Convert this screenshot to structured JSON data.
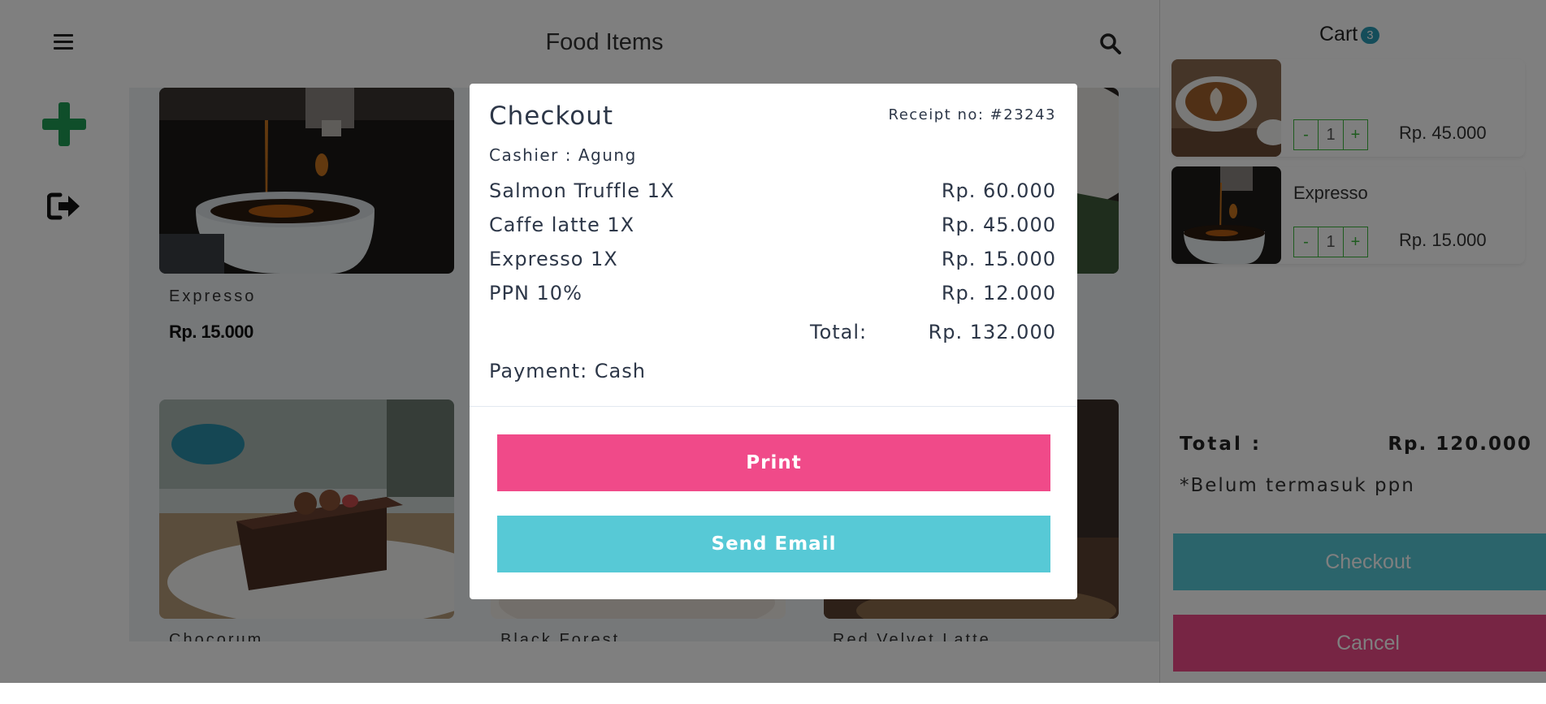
{
  "header": {
    "title": "Food Items"
  },
  "products": [
    {
      "name": "Expresso",
      "price": "Rp. 15.000"
    },
    {
      "name": "Chocorum",
      "price": ""
    },
    {
      "name": "Black Forest",
      "price": ""
    },
    {
      "name": "Red Velvet Latte",
      "price": ""
    }
  ],
  "cart": {
    "title": "Cart",
    "count": "3",
    "items": [
      {
        "name": "",
        "qty": "1",
        "price": "Rp. 45.000"
      },
      {
        "name": "Expresso",
        "qty": "1",
        "price": "Rp. 15.000"
      }
    ],
    "minus": "-",
    "plus": "+",
    "total_label": "Total :",
    "total_value": "Rp. 120.000",
    "note": "*Belum termasuk ppn",
    "checkout_label": "Checkout",
    "cancel_label": "Cancel"
  },
  "modal": {
    "title": "Checkout",
    "receipt": "Receipt no: #23243",
    "cashier": "Cashier : Agung",
    "lines": [
      {
        "label": "Salmon Truffle 1X",
        "value": "Rp. 60.000"
      },
      {
        "label": "Caffe latte 1X",
        "value": "Rp. 45.000"
      },
      {
        "label": "Expresso 1X",
        "value": "Rp. 15.000"
      },
      {
        "label": "PPN 10%",
        "value": "Rp. 12.000"
      }
    ],
    "total_label": "Total:",
    "total_value": "Rp. 132.000",
    "payment": "Payment: Cash",
    "print_label": "Print",
    "email_label": "Send Email"
  },
  "colors": {
    "print": "#f04a89",
    "email": "#57c9d6",
    "add": "#1f9d55",
    "badge": "#2a9bb5"
  },
  "icons": [
    "menu-icon",
    "plus-icon",
    "logout-icon",
    "search-icon"
  ]
}
